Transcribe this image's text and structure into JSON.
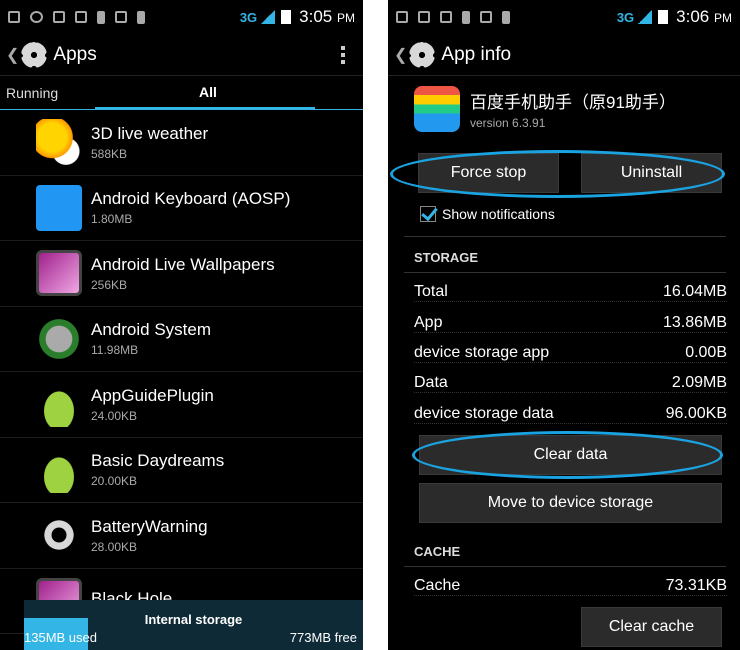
{
  "left": {
    "status": {
      "network": "3G",
      "time": "3:05",
      "ampm": "PM"
    },
    "header": {
      "title": "Apps"
    },
    "tabs": {
      "running": "Running",
      "all": "All"
    },
    "apps": [
      {
        "name": "3D live weather",
        "size": "588KB",
        "icon": "weather-icon"
      },
      {
        "name": "Android Keyboard (AOSP)",
        "size": "1.80MB",
        "icon": "keyboard-icon"
      },
      {
        "name": "Android Live Wallpapers",
        "size": "256KB",
        "icon": "wallpaper-icon"
      },
      {
        "name": "Android System",
        "size": "11.98MB",
        "icon": "system-icon"
      },
      {
        "name": "AppGuidePlugin",
        "size": "24.00KB",
        "icon": "android-icon"
      },
      {
        "name": "Basic Daydreams",
        "size": "20.00KB",
        "icon": "android-icon"
      },
      {
        "name": "BatteryWarning",
        "size": "28.00KB",
        "icon": "gear-icon"
      },
      {
        "name": "Black Hole",
        "size": "",
        "icon": "wallpaper-icon"
      }
    ],
    "storage": {
      "label": "Internal storage",
      "used": "135MB used",
      "free": "773MB free",
      "used_fraction": 0.19
    }
  },
  "right": {
    "status": {
      "network": "3G",
      "time": "3:06",
      "ampm": "PM"
    },
    "header": {
      "title": "App info"
    },
    "app": {
      "name": "百度手机助手（原91助手）",
      "version": "version 6.3.91"
    },
    "buttons": {
      "force_stop": "Force stop",
      "uninstall": "Uninstall",
      "clear_data": "Clear data",
      "move": "Move to device storage",
      "clear_cache": "Clear cache"
    },
    "show_notifications": "Show notifications",
    "storage_header": "STORAGE",
    "storage_rows": [
      {
        "label": "Total",
        "value": "16.04MB"
      },
      {
        "label": "App",
        "value": "13.86MB"
      },
      {
        "label": "device storage app",
        "value": "0.00B"
      },
      {
        "label": "Data",
        "value": "2.09MB"
      },
      {
        "label": "device storage data",
        "value": "96.00KB"
      }
    ],
    "cache_header": "CACHE",
    "cache_row": {
      "label": "Cache",
      "value": "73.31KB"
    },
    "accent": "#1aa3e0"
  }
}
